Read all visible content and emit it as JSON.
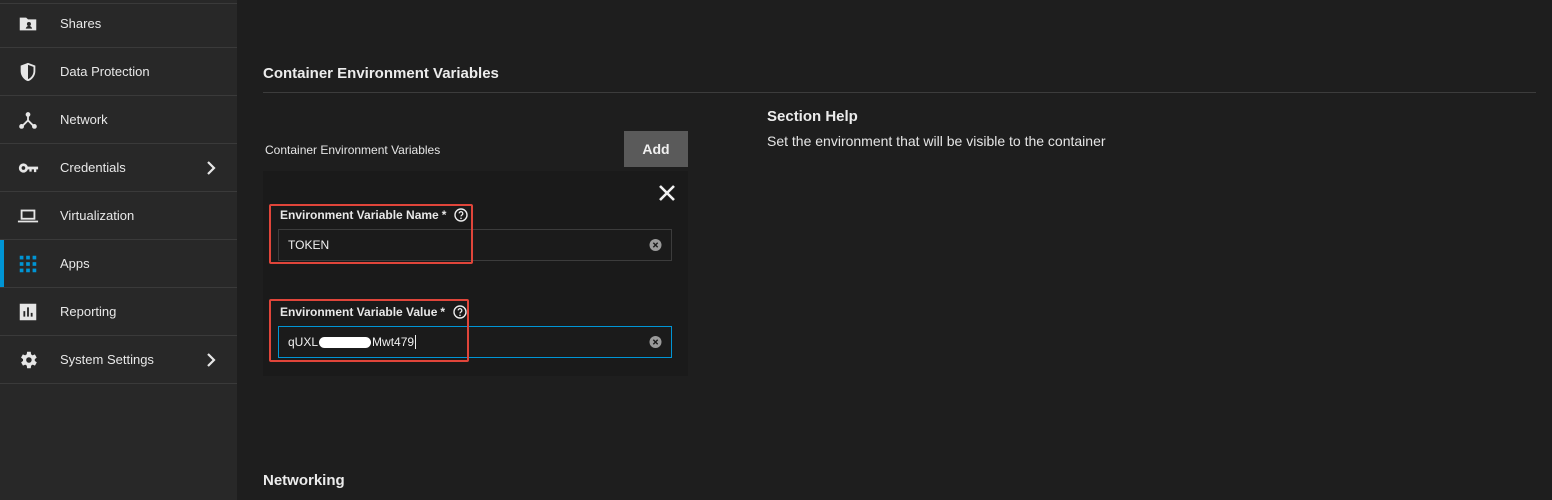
{
  "sidebar": {
    "items": [
      {
        "label": "Shares",
        "icon": "shares-icon",
        "has_chevron": false,
        "active": false
      },
      {
        "label": "Data Protection",
        "icon": "shield-icon",
        "has_chevron": false,
        "active": false
      },
      {
        "label": "Network",
        "icon": "network-icon",
        "has_chevron": false,
        "active": false
      },
      {
        "label": "Credentials",
        "icon": "key-icon",
        "has_chevron": true,
        "active": false
      },
      {
        "label": "Virtualization",
        "icon": "laptop-icon",
        "has_chevron": false,
        "active": false
      },
      {
        "label": "Apps",
        "icon": "apps-grid-icon",
        "has_chevron": false,
        "active": true
      },
      {
        "label": "Reporting",
        "icon": "reporting-icon",
        "has_chevron": false,
        "active": false
      },
      {
        "label": "System Settings",
        "icon": "gear-icon",
        "has_chevron": true,
        "active": false
      }
    ]
  },
  "main": {
    "section_title": "Container Environment Variables",
    "list_label": "Container Environment Variables",
    "add_label": "Add",
    "entry": {
      "name_label": "Environment Variable Name",
      "name_required": "*",
      "name_value": "TOKEN",
      "value_label": "Environment Variable Value",
      "value_required": "*",
      "value_prefix": "qUXL",
      "value_suffix": "Mwt479"
    },
    "help_title": "Section Help",
    "help_text": "Set the environment that will be visible to the container",
    "next_section_title": "Networking"
  },
  "colors": {
    "accent": "#0095d5",
    "highlight": "#e0453a",
    "sidebar_bg": "#282828",
    "main_bg": "#1e1e1e"
  }
}
